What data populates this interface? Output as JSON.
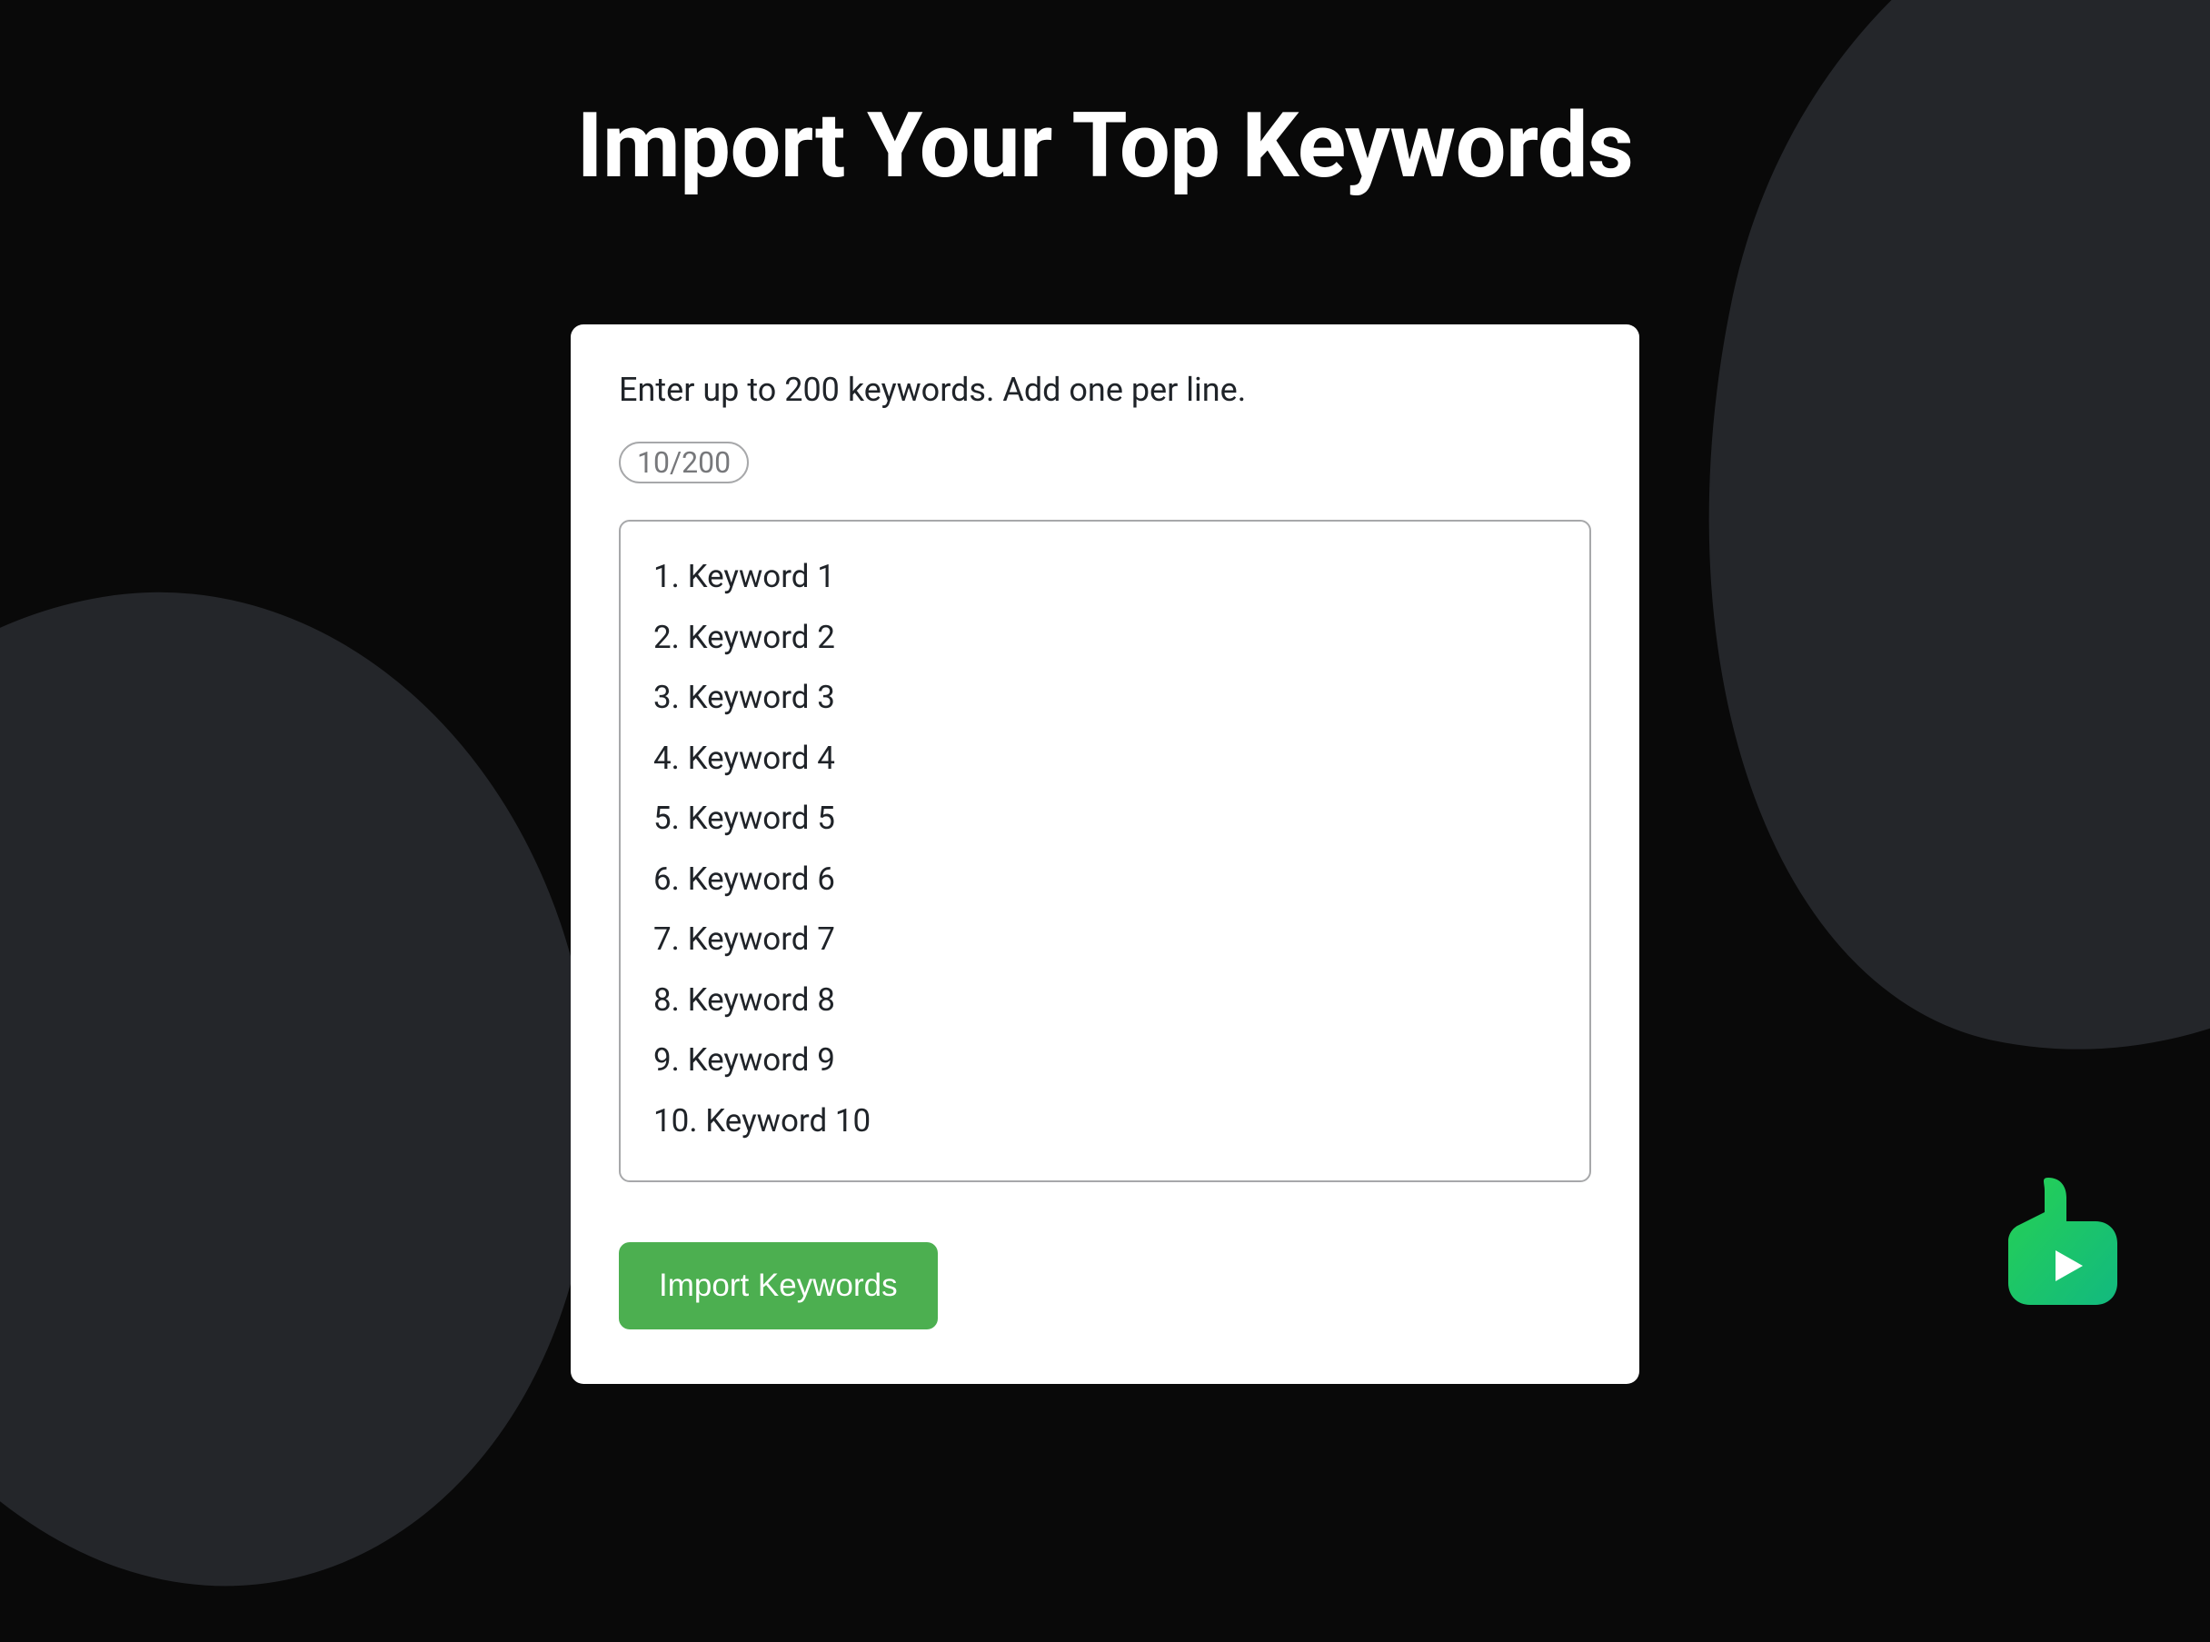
{
  "header": {
    "title": "Import Your Top Keywords"
  },
  "form": {
    "instructions": "Enter up to 200 keywords. Add one per line.",
    "count_label": "10/200",
    "keywords": [
      "1. Keyword 1",
      "2. Keyword 2",
      "3. Keyword 3",
      "4. Keyword 4",
      "5. Keyword 5",
      "6. Keyword 6",
      "7. Keyword 7",
      "8. Keyword 8",
      "9. Keyword 9",
      "10. Keyword 10"
    ],
    "import_button_label": "Import Keywords"
  },
  "colors": {
    "accent": "#4CAF50",
    "background": "#090909",
    "blob": "#24262A"
  }
}
